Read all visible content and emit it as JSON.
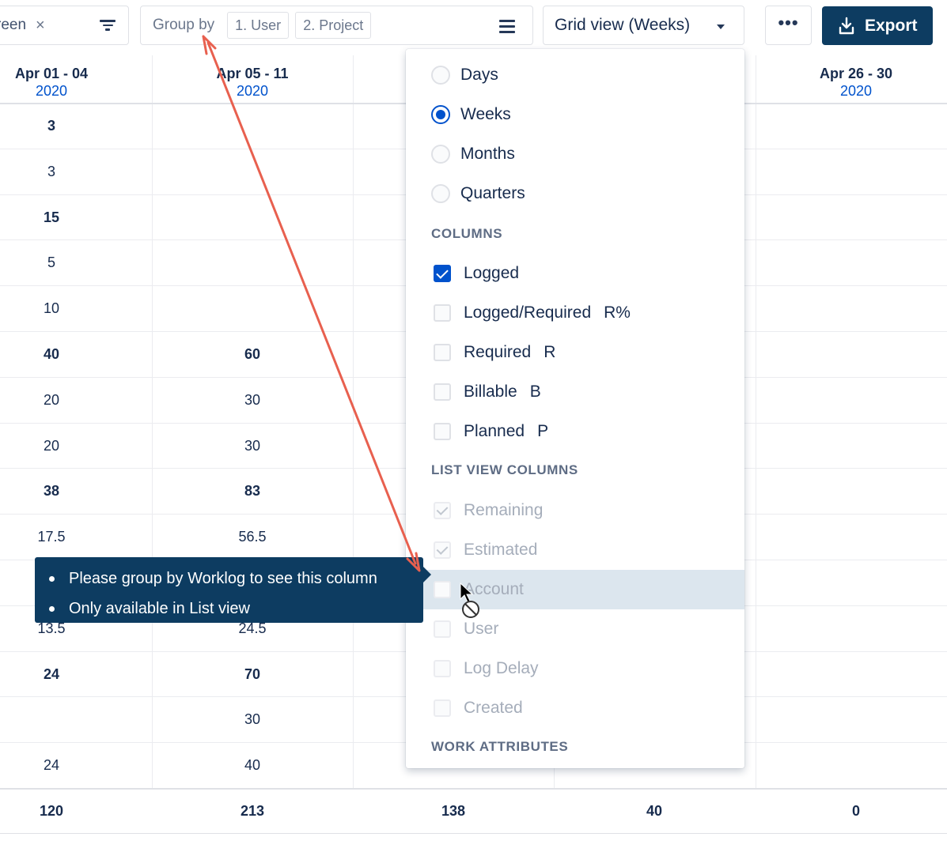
{
  "toolbar": {
    "filter_chip_text": "reen",
    "filter_chip_close": "×",
    "group_by_label": "Group by",
    "group_chips": [
      "1. User",
      "2. Project"
    ],
    "view_select": "Grid view (Weeks)",
    "more_label": "•••",
    "export_label": "Export"
  },
  "grid": {
    "columns": [
      {
        "range": "Apr 01 - 04",
        "year": "2020"
      },
      {
        "range": "Apr 05 - 11",
        "year": "2020"
      },
      {
        "range": "",
        "year": ""
      },
      {
        "range": "",
        "year": ""
      },
      {
        "range": "Apr 26 - 30",
        "year": "2020"
      }
    ],
    "rows": [
      {
        "bold": true,
        "cells": [
          "3",
          "",
          "",
          "",
          ""
        ]
      },
      {
        "bold": false,
        "cells": [
          "3",
          "",
          "",
          "",
          ""
        ]
      },
      {
        "bold": true,
        "cells": [
          "15",
          "",
          "",
          "",
          ""
        ]
      },
      {
        "bold": false,
        "cells": [
          "5",
          "",
          "",
          "",
          ""
        ]
      },
      {
        "bold": false,
        "cells": [
          "10",
          "",
          "",
          "",
          ""
        ]
      },
      {
        "bold": true,
        "cells": [
          "40",
          "60",
          "",
          "",
          ""
        ]
      },
      {
        "bold": false,
        "cells": [
          "20",
          "30",
          "",
          "",
          ""
        ]
      },
      {
        "bold": false,
        "cells": [
          "20",
          "30",
          "",
          "",
          ""
        ]
      },
      {
        "bold": true,
        "cells": [
          "38",
          "83",
          "",
          "",
          ""
        ]
      },
      {
        "bold": false,
        "cells": [
          "17.5",
          "56.5",
          "",
          "",
          ""
        ]
      },
      {
        "bold": false,
        "cells": [
          "",
          "",
          "",
          "",
          ""
        ]
      },
      {
        "bold": false,
        "cells": [
          "13.5",
          "24.5",
          "",
          "",
          ""
        ]
      },
      {
        "bold": true,
        "cells": [
          "24",
          "70",
          "",
          "",
          ""
        ]
      },
      {
        "bold": false,
        "cells": [
          "",
          "30",
          "",
          "",
          ""
        ]
      },
      {
        "bold": false,
        "cells": [
          "24",
          "40",
          "",
          "",
          ""
        ]
      }
    ],
    "totals": [
      "120",
      "213",
      "138",
      "40",
      "0"
    ]
  },
  "menu": {
    "period_options": [
      {
        "label": "Days",
        "selected": false
      },
      {
        "label": "Weeks",
        "selected": true
      },
      {
        "label": "Months",
        "selected": false
      },
      {
        "label": "Quarters",
        "selected": false
      }
    ],
    "columns_heading": "COLUMNS",
    "columns": [
      {
        "label": "Logged",
        "short": "",
        "checked": true
      },
      {
        "label": "Logged/Required",
        "short": "R%",
        "checked": false
      },
      {
        "label": "Required",
        "short": "R",
        "checked": false
      },
      {
        "label": "Billable",
        "short": "B",
        "checked": false
      },
      {
        "label": "Planned",
        "short": "P",
        "checked": false
      }
    ],
    "list_view_heading": "LIST VIEW COLUMNS",
    "list_view_columns": [
      {
        "label": "Remaining",
        "checked": true
      },
      {
        "label": "Estimated",
        "checked": true
      },
      {
        "label": "Account",
        "checked": false,
        "hovered": true
      },
      {
        "label": "User",
        "checked": false
      },
      {
        "label": "Log Delay",
        "checked": false
      },
      {
        "label": "Created",
        "checked": false
      }
    ],
    "work_attributes_heading": "WORK ATTRIBUTES"
  },
  "tooltip": {
    "lines": [
      "Please group by Worklog to see this column",
      "Only available in List view"
    ]
  },
  "colors": {
    "primary": "#0052cc",
    "export_bg": "#0d3c61",
    "annotation_arrow": "#e8604f",
    "hover_row": "#dce6ee"
  },
  "icons": [
    "close-icon",
    "filter-icon",
    "hamburger-icon",
    "caret-down-icon",
    "more-icon",
    "download-icon",
    "cursor-arrow-icon",
    "not-allowed-icon"
  ]
}
